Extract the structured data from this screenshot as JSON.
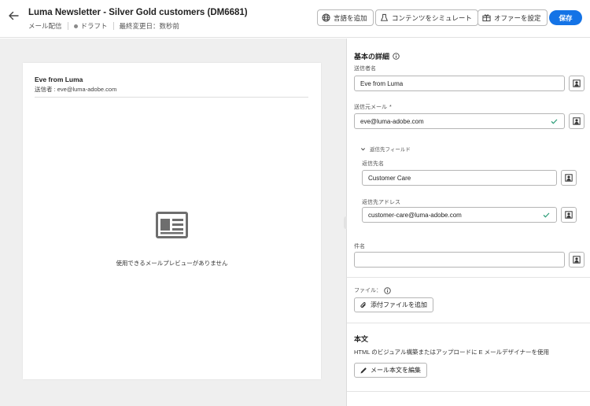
{
  "header": {
    "title": "Luma Newsletter - Silver Gold customers (DM6681)",
    "channel": "メール配信",
    "status": "ドラフト",
    "last_modified": "最終変更日：数秒前",
    "buttons": {
      "add_language": "言語を追加",
      "simulate": "コンテンツをシミュレート",
      "offers": "オファーを設定",
      "save": "保存"
    }
  },
  "preview": {
    "sender_name": "Eve from Luma",
    "sender_line": "送信者 : eve@luma-adobe.com",
    "no_preview": "使用できるメールプレビューがありません"
  },
  "panel": {
    "basic_title": "基本の詳細",
    "sender_name_label": "送信者名",
    "sender_name_value": "Eve from Luma",
    "sender_email_label": "送信元メール",
    "sender_email_value": "eve@luma-adobe.com",
    "required_mark": "*",
    "reply_toggle": "返信先フィールド",
    "reply_name_label": "返信先名",
    "reply_name_value": "Customer Care",
    "reply_address_label": "返信先アドレス",
    "reply_address_value": "customer-care@luma-adobe.com",
    "subject_label": "件名",
    "subject_value": "",
    "file_label": "ファイル：",
    "add_attachment": "添付ファイルを追加",
    "body_title": "本文",
    "body_desc": "HTML のビジュアル構築またはアップロードに E メールデザイナーを使用",
    "edit_body": "メール本文を編集"
  },
  "icons": {
    "back": "arrow-left-icon",
    "globe": "globe-icon",
    "simulate": "simulate-icon",
    "offers": "offer-icon",
    "info": "info-icon",
    "personalize": "personalization-icon",
    "check": "check-icon",
    "chevron": "chevron-down-icon",
    "attach": "paperclip-icon",
    "edit": "pencil-icon",
    "no_preview": "email-preview-icon"
  },
  "colors": {
    "accent": "#1473e6",
    "check": "#2d9d78",
    "preview_bg": "#efefef"
  }
}
